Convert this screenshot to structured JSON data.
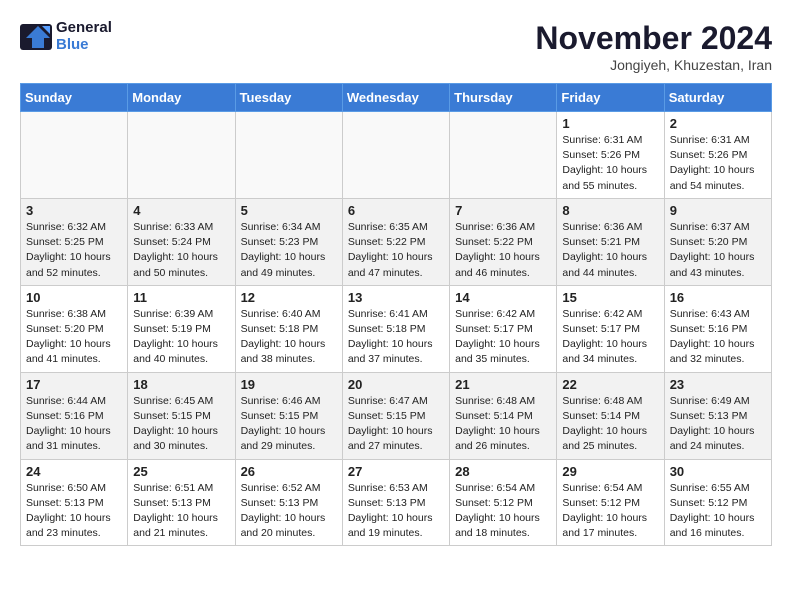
{
  "logo": {
    "general": "General",
    "blue": "Blue"
  },
  "header": {
    "month": "November 2024",
    "location": "Jongiyeh, Khuzestan, Iran"
  },
  "weekdays": [
    "Sunday",
    "Monday",
    "Tuesday",
    "Wednesday",
    "Thursday",
    "Friday",
    "Saturday"
  ],
  "weeks": [
    [
      {
        "day": "",
        "empty": true
      },
      {
        "day": "",
        "empty": true
      },
      {
        "day": "",
        "empty": true
      },
      {
        "day": "",
        "empty": true
      },
      {
        "day": "",
        "empty": true
      },
      {
        "day": "1",
        "text": "Sunrise: 6:31 AM\nSunset: 5:26 PM\nDaylight: 10 hours\nand 55 minutes."
      },
      {
        "day": "2",
        "text": "Sunrise: 6:31 AM\nSunset: 5:26 PM\nDaylight: 10 hours\nand 54 minutes."
      }
    ],
    [
      {
        "day": "3",
        "text": "Sunrise: 6:32 AM\nSunset: 5:25 PM\nDaylight: 10 hours\nand 52 minutes."
      },
      {
        "day": "4",
        "text": "Sunrise: 6:33 AM\nSunset: 5:24 PM\nDaylight: 10 hours\nand 50 minutes."
      },
      {
        "day": "5",
        "text": "Sunrise: 6:34 AM\nSunset: 5:23 PM\nDaylight: 10 hours\nand 49 minutes."
      },
      {
        "day": "6",
        "text": "Sunrise: 6:35 AM\nSunset: 5:22 PM\nDaylight: 10 hours\nand 47 minutes."
      },
      {
        "day": "7",
        "text": "Sunrise: 6:36 AM\nSunset: 5:22 PM\nDaylight: 10 hours\nand 46 minutes."
      },
      {
        "day": "8",
        "text": "Sunrise: 6:36 AM\nSunset: 5:21 PM\nDaylight: 10 hours\nand 44 minutes."
      },
      {
        "day": "9",
        "text": "Sunrise: 6:37 AM\nSunset: 5:20 PM\nDaylight: 10 hours\nand 43 minutes."
      }
    ],
    [
      {
        "day": "10",
        "text": "Sunrise: 6:38 AM\nSunset: 5:20 PM\nDaylight: 10 hours\nand 41 minutes."
      },
      {
        "day": "11",
        "text": "Sunrise: 6:39 AM\nSunset: 5:19 PM\nDaylight: 10 hours\nand 40 minutes."
      },
      {
        "day": "12",
        "text": "Sunrise: 6:40 AM\nSunset: 5:18 PM\nDaylight: 10 hours\nand 38 minutes."
      },
      {
        "day": "13",
        "text": "Sunrise: 6:41 AM\nSunset: 5:18 PM\nDaylight: 10 hours\nand 37 minutes."
      },
      {
        "day": "14",
        "text": "Sunrise: 6:42 AM\nSunset: 5:17 PM\nDaylight: 10 hours\nand 35 minutes."
      },
      {
        "day": "15",
        "text": "Sunrise: 6:42 AM\nSunset: 5:17 PM\nDaylight: 10 hours\nand 34 minutes."
      },
      {
        "day": "16",
        "text": "Sunrise: 6:43 AM\nSunset: 5:16 PM\nDaylight: 10 hours\nand 32 minutes."
      }
    ],
    [
      {
        "day": "17",
        "text": "Sunrise: 6:44 AM\nSunset: 5:16 PM\nDaylight: 10 hours\nand 31 minutes."
      },
      {
        "day": "18",
        "text": "Sunrise: 6:45 AM\nSunset: 5:15 PM\nDaylight: 10 hours\nand 30 minutes."
      },
      {
        "day": "19",
        "text": "Sunrise: 6:46 AM\nSunset: 5:15 PM\nDaylight: 10 hours\nand 29 minutes."
      },
      {
        "day": "20",
        "text": "Sunrise: 6:47 AM\nSunset: 5:15 PM\nDaylight: 10 hours\nand 27 minutes."
      },
      {
        "day": "21",
        "text": "Sunrise: 6:48 AM\nSunset: 5:14 PM\nDaylight: 10 hours\nand 26 minutes."
      },
      {
        "day": "22",
        "text": "Sunrise: 6:48 AM\nSunset: 5:14 PM\nDaylight: 10 hours\nand 25 minutes."
      },
      {
        "day": "23",
        "text": "Sunrise: 6:49 AM\nSunset: 5:13 PM\nDaylight: 10 hours\nand 24 minutes."
      }
    ],
    [
      {
        "day": "24",
        "text": "Sunrise: 6:50 AM\nSunset: 5:13 PM\nDaylight: 10 hours\nand 23 minutes."
      },
      {
        "day": "25",
        "text": "Sunrise: 6:51 AM\nSunset: 5:13 PM\nDaylight: 10 hours\nand 21 minutes."
      },
      {
        "day": "26",
        "text": "Sunrise: 6:52 AM\nSunset: 5:13 PM\nDaylight: 10 hours\nand 20 minutes."
      },
      {
        "day": "27",
        "text": "Sunrise: 6:53 AM\nSunset: 5:13 PM\nDaylight: 10 hours\nand 19 minutes."
      },
      {
        "day": "28",
        "text": "Sunrise: 6:54 AM\nSunset: 5:12 PM\nDaylight: 10 hours\nand 18 minutes."
      },
      {
        "day": "29",
        "text": "Sunrise: 6:54 AM\nSunset: 5:12 PM\nDaylight: 10 hours\nand 17 minutes."
      },
      {
        "day": "30",
        "text": "Sunrise: 6:55 AM\nSunset: 5:12 PM\nDaylight: 10 hours\nand 16 minutes."
      }
    ]
  ]
}
